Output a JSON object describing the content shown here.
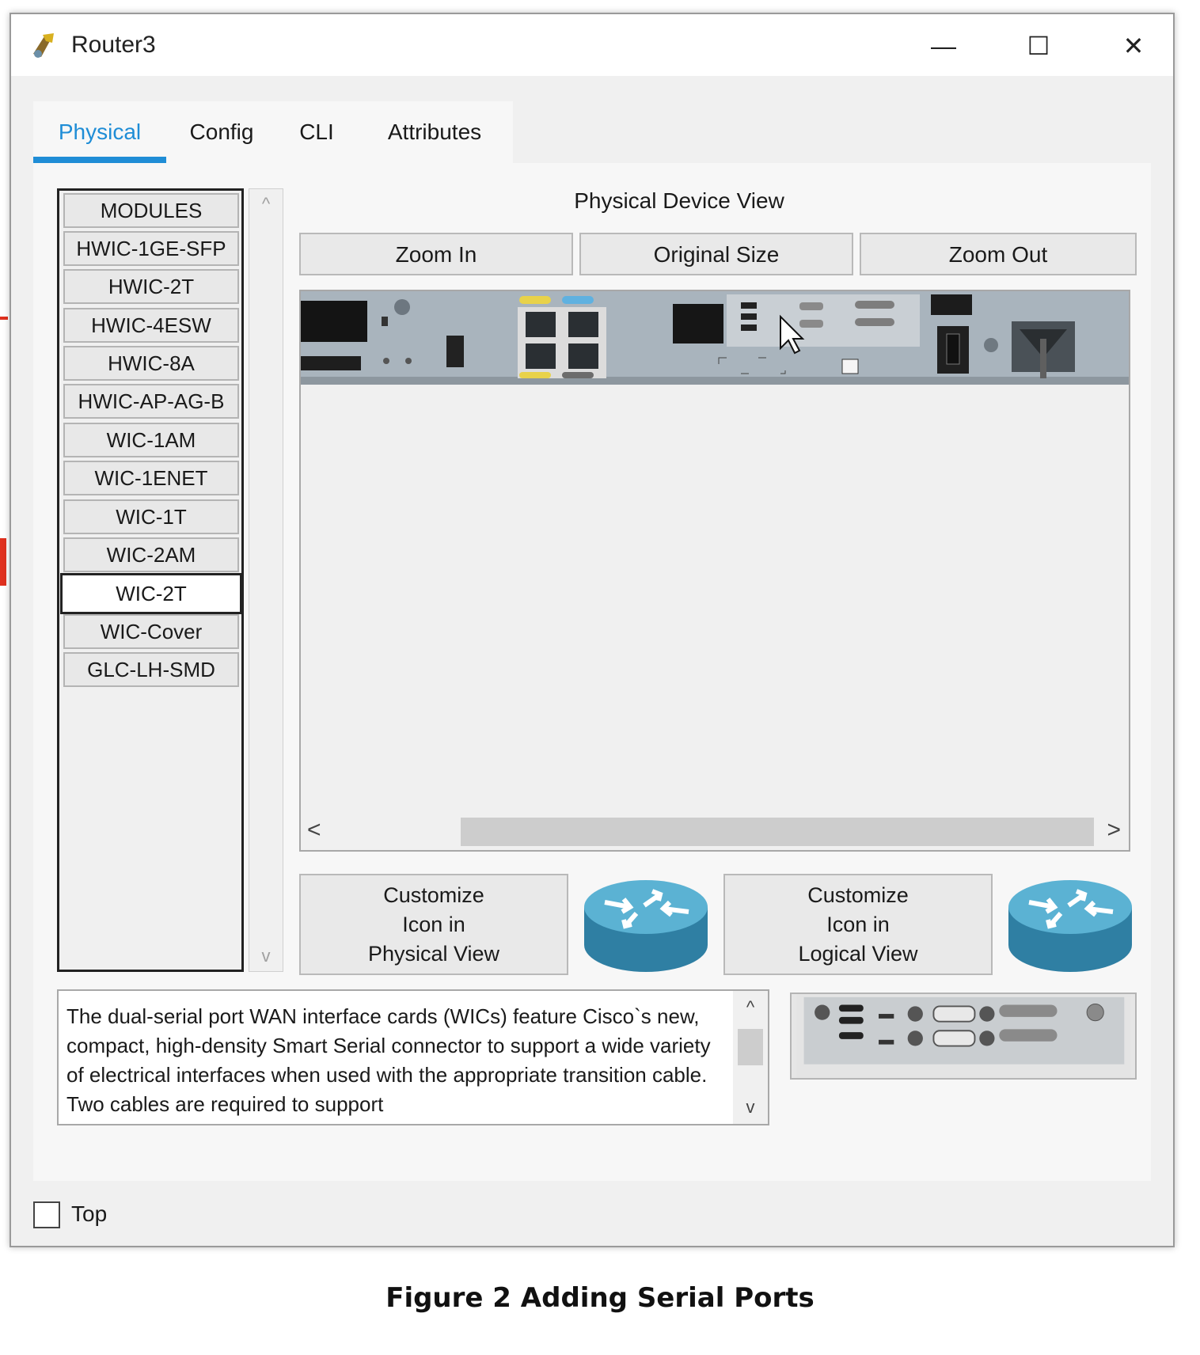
{
  "window": {
    "title": "Router3",
    "icons": {
      "app": "router-app-icon",
      "minimize": "minimize-icon",
      "maximize": "maximize-icon",
      "close": "close-icon"
    },
    "minimize_glyph": "—",
    "maximize_glyph": "☐",
    "close_glyph": "✕"
  },
  "tabs": [
    {
      "label": "Physical",
      "active": true
    },
    {
      "label": "Config",
      "active": false
    },
    {
      "label": "CLI",
      "active": false
    },
    {
      "label": "Attributes",
      "active": false
    }
  ],
  "modules": {
    "items": [
      "MODULES",
      "HWIC-1GE-SFP",
      "HWIC-2T",
      "HWIC-4ESW",
      "HWIC-8A",
      "HWIC-AP-AG-B",
      "WIC-1AM",
      "WIC-1ENET",
      "WIC-1T",
      "WIC-2AM",
      "WIC-2T",
      "WIC-Cover",
      "GLC-LH-SMD"
    ],
    "selected": "WIC-2T",
    "scroll_up": "^",
    "scroll_down": "v"
  },
  "device_view": {
    "title": "Physical Device View",
    "zoom_in": "Zoom In",
    "original_size": "Original Size",
    "zoom_out": "Zoom Out",
    "scroll_left": "<",
    "scroll_right": ">"
  },
  "customize": {
    "physical": [
      "Customize",
      "Icon in",
      "Physical View"
    ],
    "logical": [
      "Customize",
      "Icon in",
      "Logical View"
    ]
  },
  "description": {
    "text": "The dual-serial port WAN interface cards (WICs) feature Cisco`s new, compact, high-density Smart Serial connector to support a wide variety of electrical interfaces when used with the appropriate transition cable. Two cables are required to support",
    "scroll_up": "^",
    "scroll_down": "v"
  },
  "top_checkbox": {
    "label": "Top",
    "checked": false
  },
  "caption": "Figure 2 Adding Serial Ports",
  "colors": {
    "accent": "#1f8dd6",
    "router_icon": "#3f9fc3",
    "background_line": "#e0301e"
  }
}
